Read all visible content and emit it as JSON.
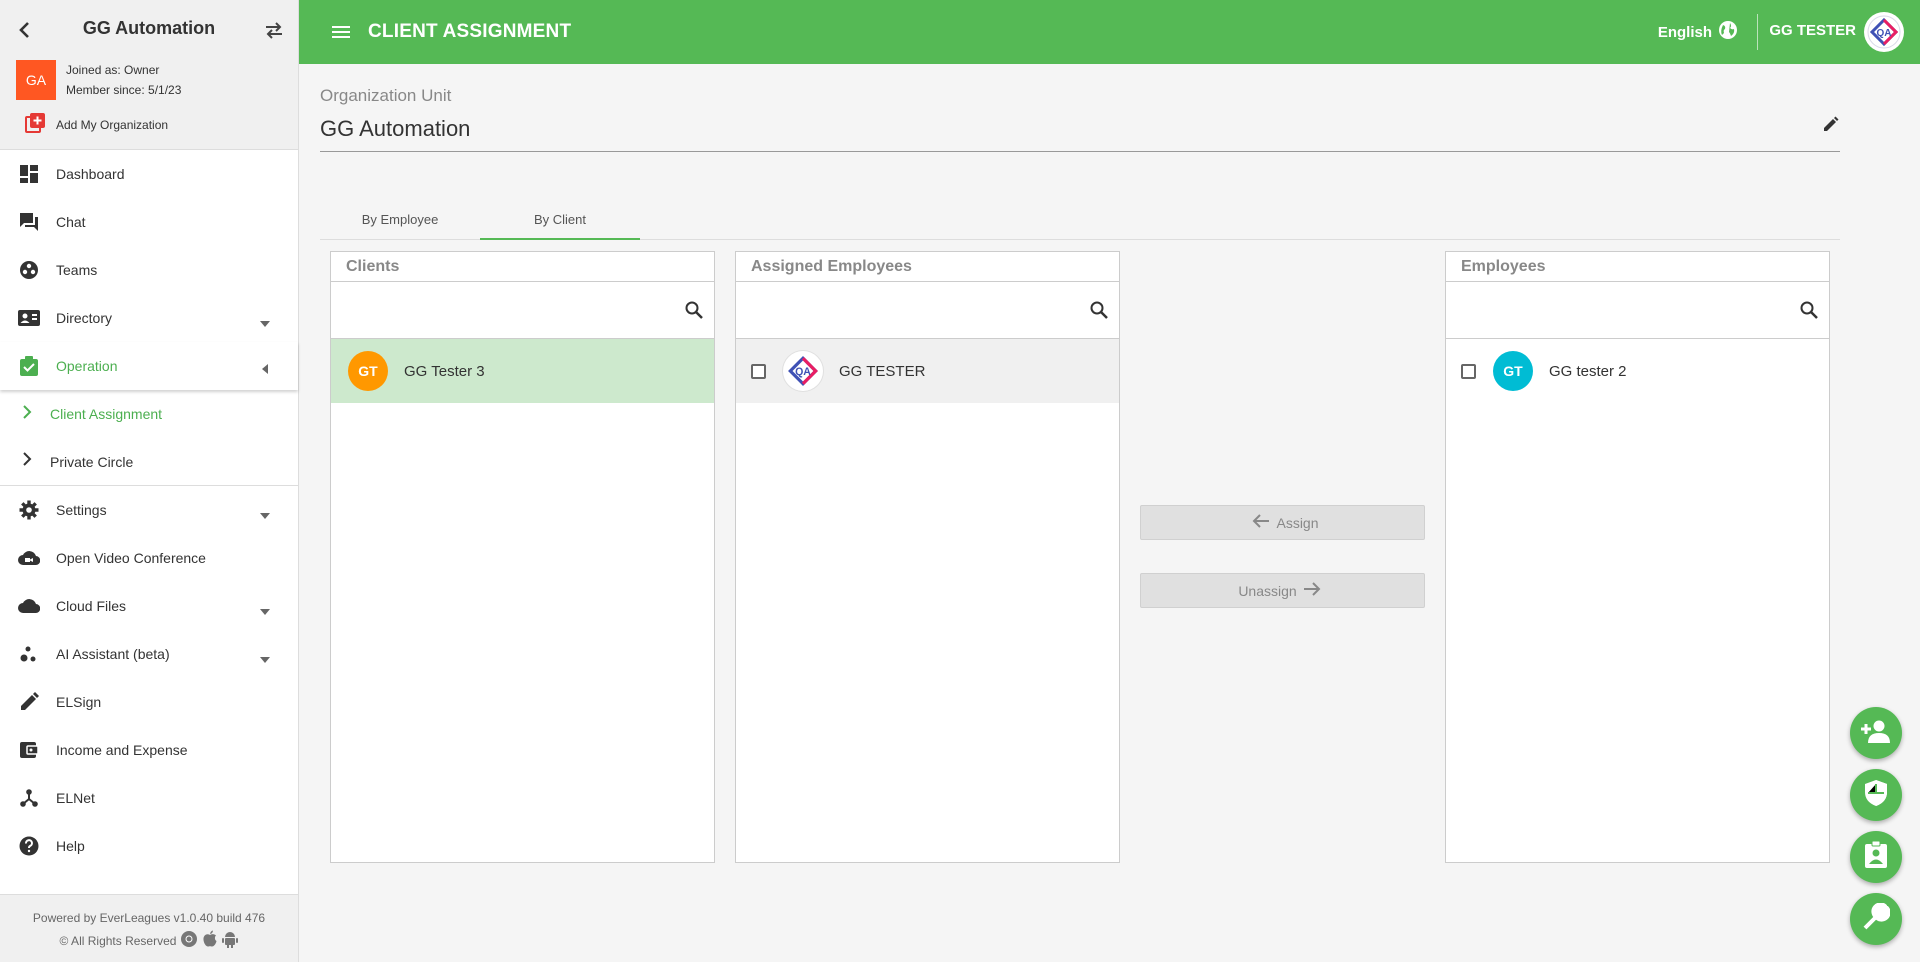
{
  "sidebar": {
    "org_name": "GG Automation",
    "avatar_initials": "GA",
    "joined_as": "Joined as: Owner",
    "member_since": "Member since: 5/1/23",
    "add_org_label": "Add My Organization",
    "nav": {
      "dashboard": "Dashboard",
      "chat": "Chat",
      "teams": "Teams",
      "directory": "Directory",
      "operation": "Operation",
      "client_assignment": "Client Assignment",
      "private_circle": "Private Circle",
      "settings": "Settings",
      "open_video_conference": "Open Video Conference",
      "cloud_files": "Cloud Files",
      "ai_assistant": "AI Assistant (beta)",
      "elsign": "ELSign",
      "income_expense": "Income and Expense",
      "elnet": "ELNet",
      "help": "Help"
    },
    "footer_powered": "Powered by EverLeagues v1.0.40 build 476",
    "footer_rights": "© All Rights Reserved"
  },
  "topbar": {
    "title": "CLIENT ASSIGNMENT",
    "language": "English",
    "user_name": "GG TESTER"
  },
  "org_unit": {
    "label": "Organization Unit",
    "value": "GG Automation"
  },
  "tabs": {
    "by_employee": "By Employee",
    "by_client": "By Client",
    "active": "By Client"
  },
  "clients_panel": {
    "title": "Clients",
    "search_placeholder": "",
    "items": [
      {
        "initials": "GT",
        "name": "GG Tester 3",
        "color": "#ff9800"
      }
    ]
  },
  "assigned_panel": {
    "title": "Assigned Employees",
    "search_placeholder": "",
    "items": [
      {
        "name": "GG TESTER"
      }
    ]
  },
  "employees_panel": {
    "title": "Employees",
    "search_placeholder": "",
    "items": [
      {
        "initials": "GT",
        "name": "GG tester 2",
        "color": "#00bcd4"
      }
    ]
  },
  "actions": {
    "assign": "Assign",
    "unassign": "Unassign"
  },
  "colors": {
    "primary": "#55b955",
    "selected_row": "#cde9cd",
    "org_avatar": "#ff5722"
  }
}
